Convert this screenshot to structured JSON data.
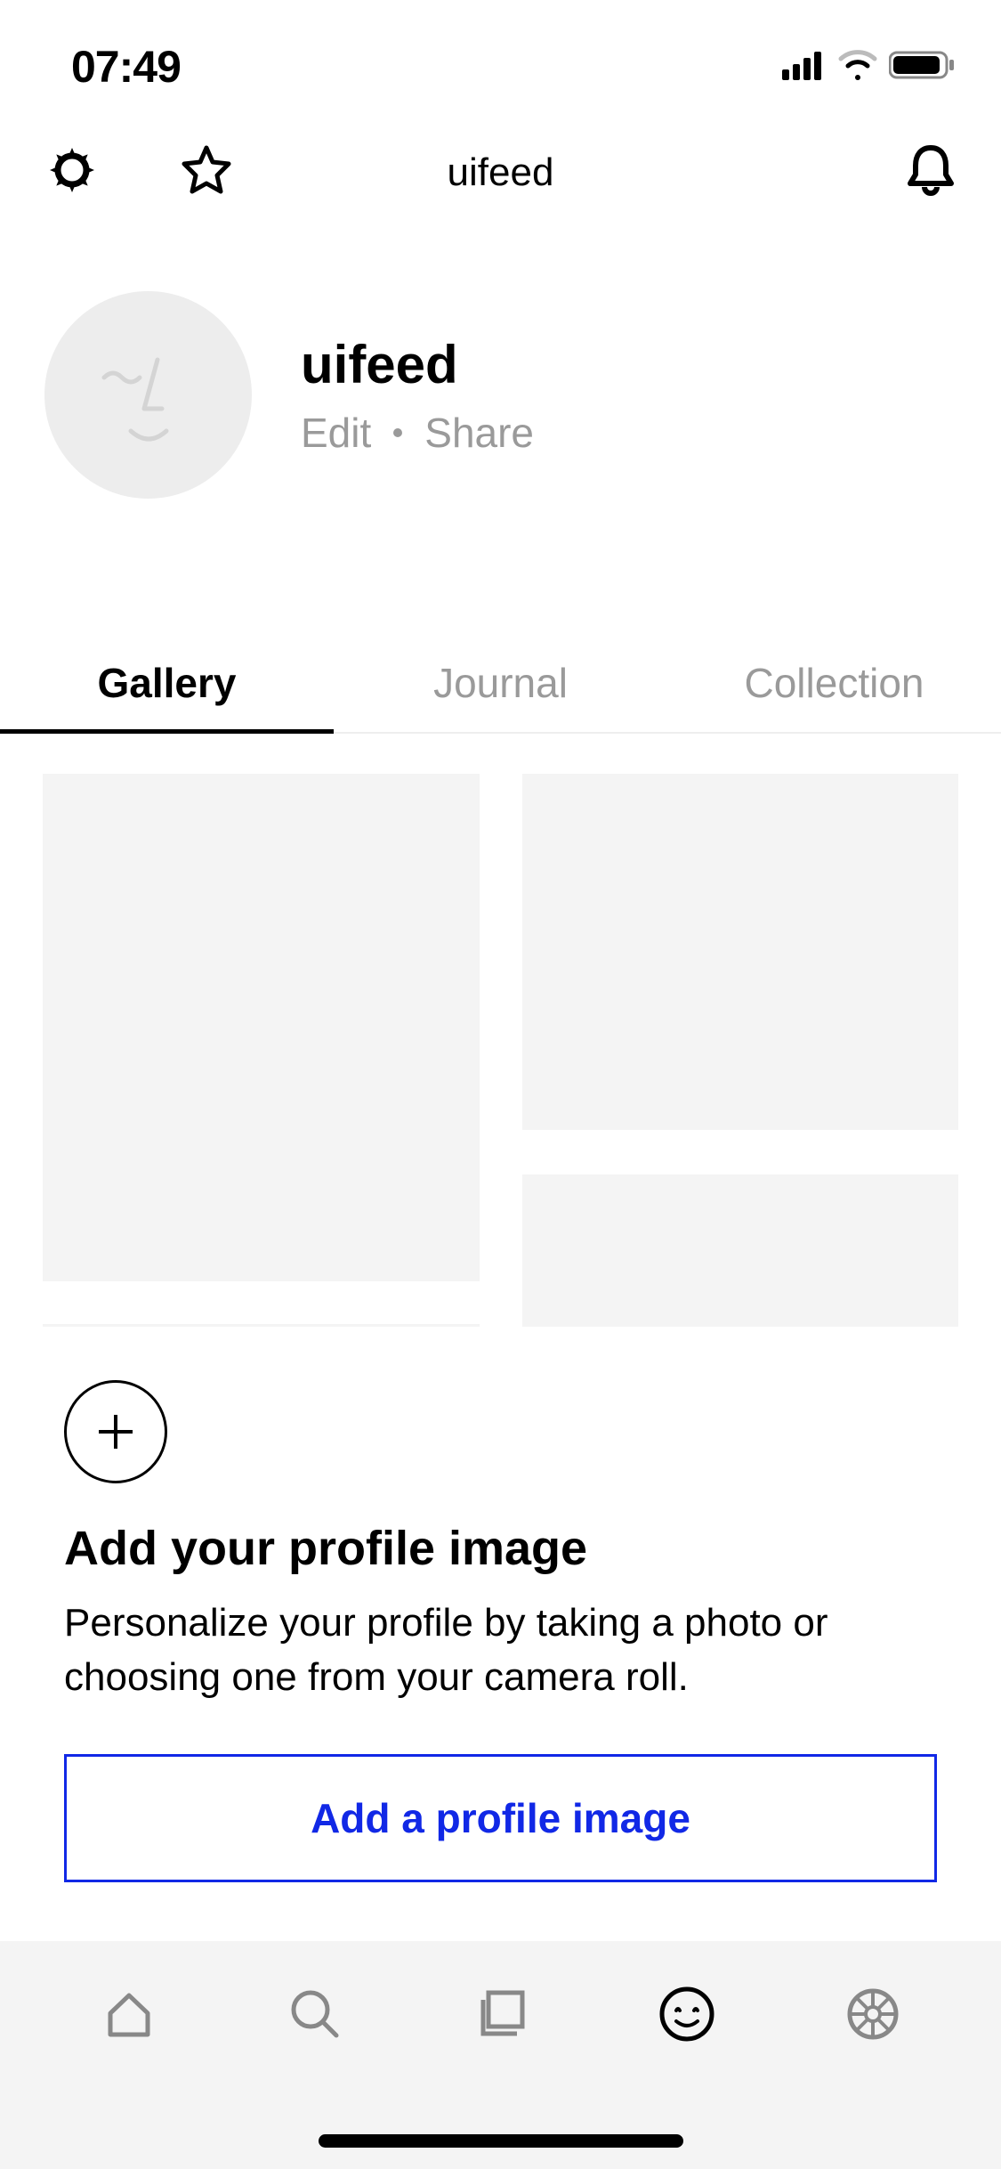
{
  "status": {
    "time": "07:49"
  },
  "header": {
    "title": "uifeed"
  },
  "profile": {
    "username": "uifeed",
    "edit_label": "Edit",
    "share_label": "Share"
  },
  "tabs": [
    {
      "label": "Gallery",
      "active": true
    },
    {
      "label": "Journal",
      "active": false
    },
    {
      "label": "Collection",
      "active": false
    }
  ],
  "prompt": {
    "title": "Add your profile image",
    "description": "Personalize your profile by taking a photo or choosing one from your camera roll.",
    "button_label": "Add a profile image"
  },
  "colors": {
    "accent": "#1128e6",
    "muted": "#9a9a9a",
    "surface": "#f4f4f4"
  }
}
